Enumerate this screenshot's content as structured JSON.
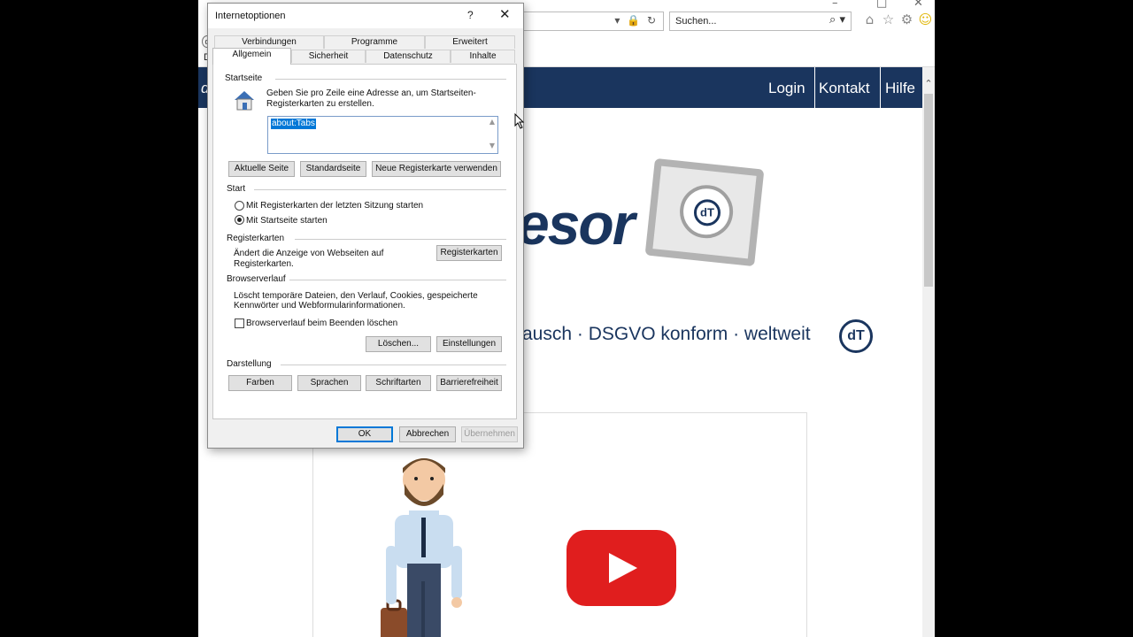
{
  "browser": {
    "search_placeholder": "Suchen...",
    "cmd_stub": "D",
    "window_controls": [
      "–",
      "□",
      "✕"
    ]
  },
  "site": {
    "nav": [
      "Login",
      "Kontakt",
      "Hilfe"
    ],
    "brand_fragment": "esor",
    "logo_badge": "dT",
    "tagline": "ausch · DSGVO konform · weltweit",
    "tagline_badge": "dT",
    "nav_left_stub": "d"
  },
  "dialog": {
    "title": "Internetoptionen",
    "help": "?",
    "tabs_back": [
      "Verbindungen",
      "Programme",
      "Erweitert"
    ],
    "tabs_front": [
      "Allgemein",
      "Sicherheit",
      "Datenschutz",
      "Inhalte"
    ],
    "startseite": {
      "label": "Startseite",
      "desc_line1": "Geben Sie pro Zeile eine Adresse an, um Startseiten-",
      "desc_line2": "Registerkarten zu erstellen.",
      "value": "about:Tabs",
      "btn_current": "Aktuelle Seite",
      "btn_default": "Standardseite",
      "btn_newtab": "Neue Registerkarte verwenden"
    },
    "start": {
      "label": "Start",
      "opt1": "Mit Registerkarten der letzten Sitzung starten",
      "opt2": "Mit Startseite starten"
    },
    "registerkarten": {
      "label": "Registerkarten",
      "desc_line1": "Ändert die Anzeige von Webseiten auf",
      "desc_line2": "Registerkarten.",
      "btn": "Registerkarten"
    },
    "verlauf": {
      "label": "Browserverlauf",
      "desc_line1": "Löscht temporäre Dateien, den Verlauf, Cookies, gespeicherte",
      "desc_line2": "Kennwörter und Webformularinformationen.",
      "checkbox": "Browserverlauf beim Beenden löschen",
      "btn_delete": "Löschen...",
      "btn_settings": "Einstellungen"
    },
    "darstellung": {
      "label": "Darstellung",
      "btn_colors": "Farben",
      "btn_languages": "Sprachen",
      "btn_fonts": "Schriftarten",
      "btn_access": "Barrierefreiheit"
    },
    "footer": {
      "ok": "OK",
      "cancel": "Abbrechen",
      "apply": "Übernehmen"
    }
  }
}
